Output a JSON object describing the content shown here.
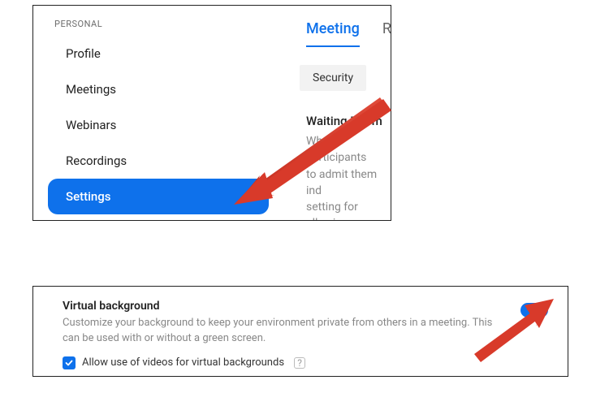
{
  "sidebar": {
    "header": "PERSONAL",
    "items": [
      {
        "label": "Profile"
      },
      {
        "label": "Meetings"
      },
      {
        "label": "Webinars"
      },
      {
        "label": "Recordings"
      },
      {
        "label": "Settings"
      }
    ]
  },
  "tabs": {
    "items": [
      {
        "label": "Meeting"
      },
      {
        "label": "Re"
      }
    ]
  },
  "security": {
    "chip": "Security",
    "waiting_room": {
      "title": "Waiting Room",
      "desc_line1": "When participants",
      "desc_line2": "to admit them ind",
      "desc_line3": "setting for allowin"
    }
  },
  "virtual_bg": {
    "title": "Virtual background",
    "desc": "Customize your background to keep your environment private from others in a meeting. This can be used with or without a green screen.",
    "checkbox_label": "Allow use of videos for virtual backgrounds"
  },
  "colors": {
    "accent": "#0e71eb",
    "arrow": "#d83a2a"
  }
}
